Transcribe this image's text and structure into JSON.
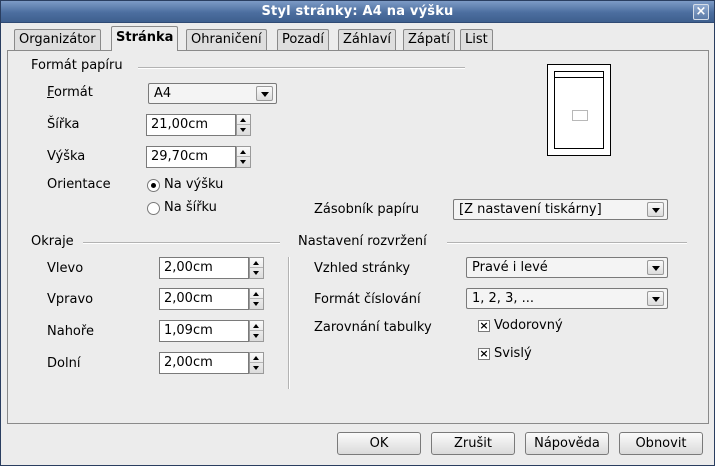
{
  "window": {
    "title": "Styl stránky: A4 na výšku"
  },
  "tabs": [
    {
      "label": "Organizátor"
    },
    {
      "label": "Stránka"
    },
    {
      "label": "Ohraničení"
    },
    {
      "label": "Pozadí"
    },
    {
      "label": "Záhlaví"
    },
    {
      "label": "Zápatí"
    },
    {
      "label": "List"
    }
  ],
  "paper_format": {
    "section_title": "Formát papíru",
    "format_label": "Formát",
    "format_value": "A4",
    "width_label": "Šířka",
    "width_value": "21,00cm",
    "height_label": "Výška",
    "height_value": "29,70cm",
    "orientation_label": "Orientace",
    "portrait_label": "Na výšku",
    "landscape_label": "Na šířku",
    "orientation_selected": "portrait",
    "paper_tray_label": "Zásobník papíru",
    "paper_tray_value": "[Z nastavení tiskárny]"
  },
  "margins": {
    "section_title": "Okraje",
    "left_label": "Vlevo",
    "left_value": "2,00cm",
    "right_label": "Vpravo",
    "right_value": "2,00cm",
    "top_label": "Nahoře",
    "top_value": "1,09cm",
    "bottom_label": "Dolní",
    "bottom_value": "2,00cm"
  },
  "layout": {
    "section_title": "Nastavení rozvržení",
    "page_layout_label": "Vzhled stránky",
    "page_layout_value": "Pravé i levé",
    "numbering_label": "Formát číslování",
    "numbering_value": "1, 2, 3, ...",
    "table_align_label": "Zarovnání tabulky",
    "horizontal_label": "Vodorovný",
    "horizontal_checked": true,
    "vertical_label": "Svislý",
    "vertical_checked": true
  },
  "buttons": {
    "ok": "OK",
    "cancel": "Zrušit",
    "help": "Nápověda",
    "reset": "Obnovit"
  }
}
